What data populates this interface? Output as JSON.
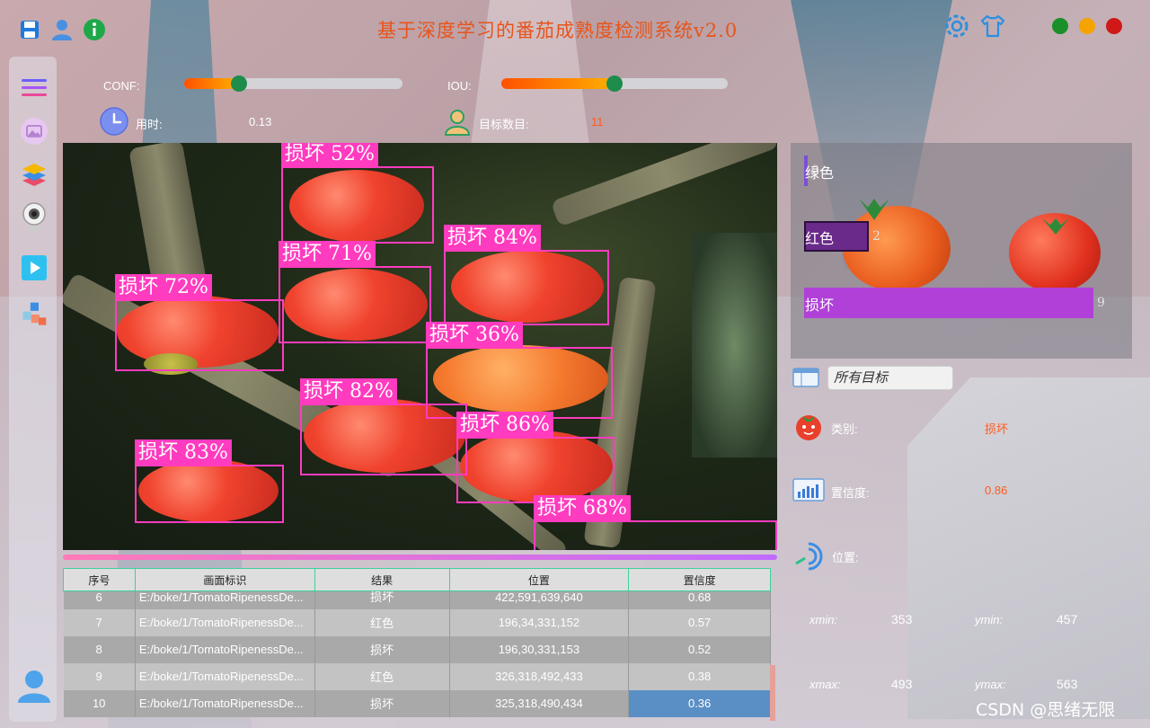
{
  "app": {
    "title": "基于深度学习的番茄成熟度检测系统v2.0",
    "accent": "#e8541a"
  },
  "toolbar_left": [
    {
      "icon": "save-icon"
    },
    {
      "icon": "user-icon"
    },
    {
      "icon": "info-icon"
    }
  ],
  "toolbar_right": [
    {
      "icon": "gear-icon"
    },
    {
      "icon": "shirt-icon"
    }
  ],
  "window_controls": {
    "maximize_color": "#1a8f2a",
    "minimize_color": "#f5a300",
    "close_color": "#d01818"
  },
  "sidebar": {
    "items": [
      {
        "icon": "menu-icon"
      },
      {
        "icon": "image-icon"
      },
      {
        "icon": "layers-icon"
      },
      {
        "icon": "webcam-icon"
      },
      {
        "icon": "video-icon"
      },
      {
        "icon": "model-cubes-icon"
      }
    ],
    "bottom_icon": "avatar-icon"
  },
  "controls": {
    "conf_label": "CONF:",
    "conf_value": 0.25,
    "iou_label": "IOU:",
    "iou_value": 0.5,
    "time_label": "用时:",
    "time_value": "0.13",
    "count_label": "目标数目:",
    "count_value": "11"
  },
  "detections": [
    {
      "label": "损坏",
      "score": "52%"
    },
    {
      "label": "损坏",
      "score": "71%"
    },
    {
      "label": "损坏",
      "score": "84%"
    },
    {
      "label": "损坏",
      "score": "72%"
    },
    {
      "label": "损坏",
      "score": "36%"
    },
    {
      "label": "损坏",
      "score": "82%"
    },
    {
      "label": "损坏",
      "score": "86%"
    },
    {
      "label": "损坏",
      "score": "83%"
    },
    {
      "label": "损坏",
      "score": "68%"
    }
  ],
  "table": {
    "headers": [
      "序号",
      "画面标识",
      "结果",
      "位置",
      "置信度"
    ],
    "rows": [
      {
        "idx": "6",
        "path": "E:/boke/1/TomatoRipenessDe...",
        "result": "损坏",
        "pos": "422,591,639,640",
        "conf": "0.68"
      },
      {
        "idx": "7",
        "path": "E:/boke/1/TomatoRipenessDe...",
        "result": "红色",
        "pos": "196,34,331,152",
        "conf": "0.57"
      },
      {
        "idx": "8",
        "path": "E:/boke/1/TomatoRipenessDe...",
        "result": "损坏",
        "pos": "196,30,331,153",
        "conf": "0.52"
      },
      {
        "idx": "9",
        "path": "E:/boke/1/TomatoRipenessDe...",
        "result": "红色",
        "pos": "326,318,492,433",
        "conf": "0.38"
      },
      {
        "idx": "10",
        "path": "E:/boke/1/TomatoRipenessDe...",
        "result": "损坏",
        "pos": "325,318,490,434",
        "conf": "0.36"
      }
    ]
  },
  "chart_data": {
    "type": "bar",
    "orientation": "horizontal",
    "categories": [
      "绿色",
      "红色",
      "损坏"
    ],
    "values": [
      0,
      2,
      9
    ],
    "colors": [
      "#7a4fd8",
      "#6a2a8a",
      "#b040d8"
    ],
    "xlim": [
      0,
      9
    ]
  },
  "filter": {
    "value": "所有目标",
    "icon": "table-icon"
  },
  "info": {
    "class_label": "类别:",
    "class_value": "损坏",
    "class_icon": "tomato-icon",
    "conf_label": "置信度:",
    "conf_value": "0.86",
    "conf_icon": "chart-icon",
    "pos_label": "位置:",
    "pos_icon": "signal-icon",
    "xmin_label": "xmin:",
    "xmin": "353",
    "ymin_label": "ymin:",
    "ymin": "457",
    "xmax_label": "xmax:",
    "xmax": "493",
    "ymax_label": "ymax:",
    "ymax": "563"
  },
  "watermark": "CSDN @思绪无限"
}
